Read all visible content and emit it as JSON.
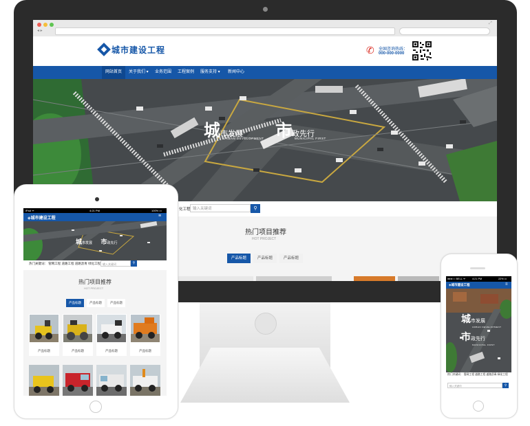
{
  "colors": {
    "brand": "#1657a8",
    "hotline": "#d9261c",
    "frame": "#2b2b2b"
  },
  "site": {
    "logo": "城市建设工程",
    "hotline_label": "全国咨询热线：",
    "hotline_number": "000-000-0000",
    "nav": [
      "网站首页",
      "关于我们 ▾",
      "业务范围",
      "工程案例",
      "服务支持 ▾",
      "新闻中心"
    ],
    "hero": {
      "line1_big": "城",
      "line1_rest": "市发展",
      "line1_en": "URBAN DEVELOPMENT",
      "line2_big": "市",
      "line2_rest": "政先行",
      "line2_en": "MUNICIPAL FIRST"
    },
    "search": {
      "keywords_label": "热门关键词：  管网工程  道路工程  道路沥青  绿化工程",
      "keywords_desktop": "化工程",
      "placeholder": "输入关键词",
      "button_icon": "search-icon"
    },
    "section": {
      "title": "热门项目推荐",
      "subtitle": "HOT PROJECT",
      "tabs": [
        "产品标题",
        "产品标题",
        "产品标题"
      ]
    },
    "products": [
      {
        "caption": "产品标题"
      },
      {
        "caption": "产品标题"
      },
      {
        "caption": "产品标题"
      },
      {
        "caption": "产品标题"
      }
    ]
  },
  "tablet": {
    "status_left": "iPad ᯤ",
    "status_time": "4:21 PM",
    "status_right": "100% ▭"
  },
  "phone": {
    "status_left": "●●●○○ BELL ᯤ",
    "status_time": "4:21 PM",
    "status_right": "22% ▭",
    "keywords": "热门关键词：  管网工程  道路工程  道路沥青  绿化工程"
  }
}
